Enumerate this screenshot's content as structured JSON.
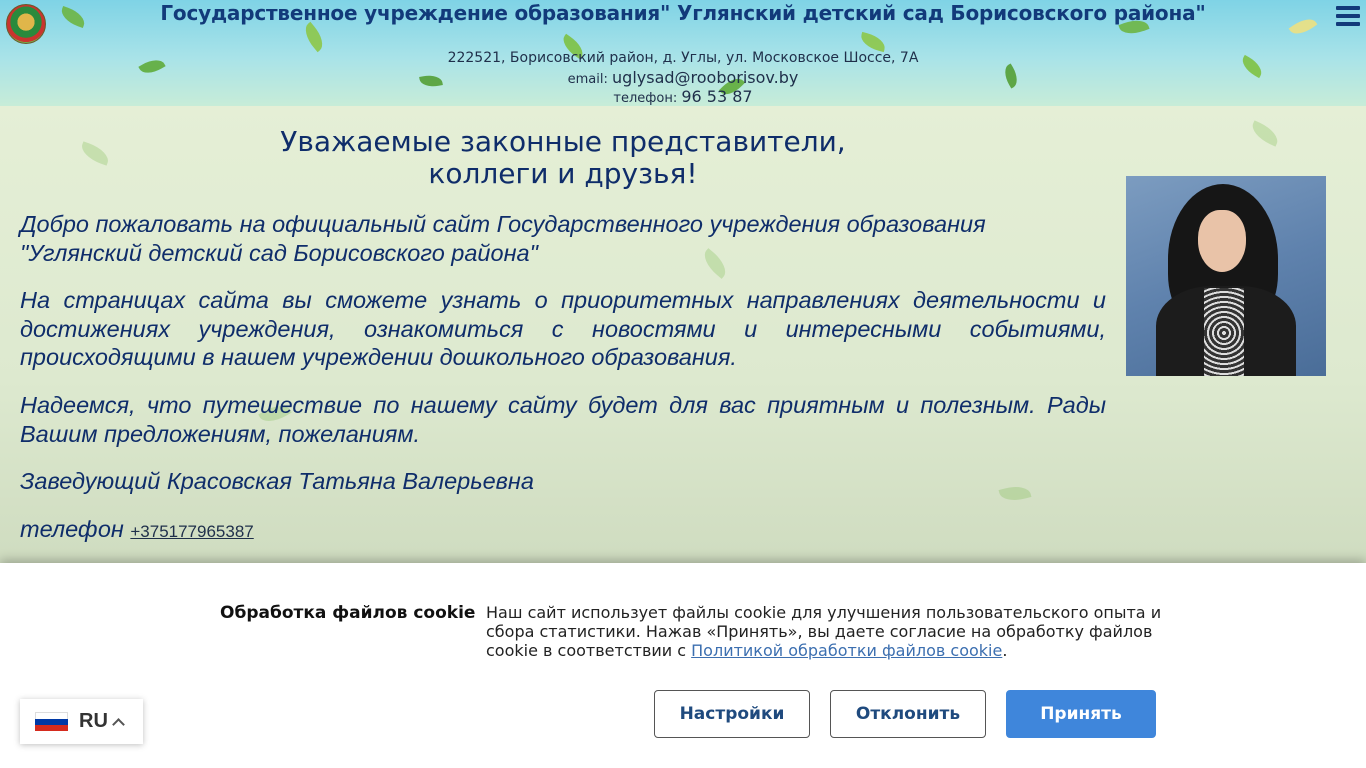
{
  "header": {
    "title": "Государственное учреждение образования\" Углянский детский сад Борисовского района\"",
    "address": "222521, Борисовский район, д. Углы, ул. Московское Шоссе, 7А",
    "email_label": "email:",
    "email": "uglysad@rooborisov.by",
    "phone_label": "телефон:",
    "phone": "96 53 87"
  },
  "main": {
    "greeting_line1": "Уважаемые законные представители,",
    "greeting_line2": "коллеги и друзья!",
    "p1": "Добро пожаловать на официальный сайт Государственного учреждения образования \"Углянский детский сад Борисовского района\"",
    "p2": "На страницах сайта вы сможете узнать о приоритетных направлениях деятельности и достижениях учреждения, ознакомиться с новостями и интересными событиями, происходящими в нашем учреждении дошкольного образования.",
    "p3": "Надеемся, что путешествие по нашему сайту будет для вас приятным и полезным. Рады Вашим предложениям, пожеланиям.",
    "p4": "Заведующий Красовская Татьяна Валерьевна",
    "phone_label": "телефон",
    "phone_link": "+375177965387"
  },
  "cookie": {
    "title": "Обработка файлов cookie",
    "text_before": "Наш сайт использует файлы cookie для улучшения пользовательского опыта и сбора статистики. Нажав «Принять», вы даете согласие на обработку файлов cookie в соответствии с ",
    "policy_link": "Политикой обработки файлов cookie",
    "text_after": ".",
    "settings_label": "Настройки",
    "decline_label": "Отклонить",
    "accept_label": "Принять"
  },
  "language": {
    "code": "RU",
    "flag_colors": [
      "#ffffff",
      "#0039a6",
      "#d52b1e"
    ]
  },
  "colors": {
    "accent": "#3f86db",
    "title_blue": "#123a7a"
  },
  "icons": {
    "emblem": "emblem-icon",
    "menu": "hamburger-menu-icon",
    "flag": "russia-flag-icon",
    "chevron": "chevron-up-icon"
  }
}
